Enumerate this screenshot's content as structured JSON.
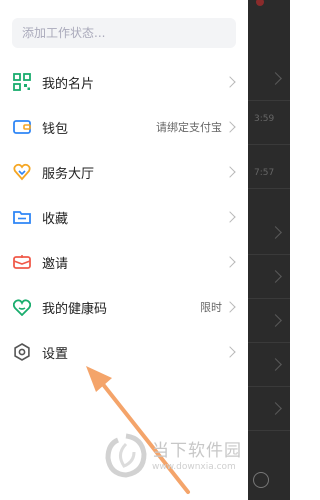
{
  "status": {
    "placeholder": "添加工作状态..."
  },
  "menu": [
    {
      "label": "我的名片",
      "hint": "",
      "icon": "qr-card-icon"
    },
    {
      "label": "钱包",
      "hint": "请绑定支付宝",
      "icon": "wallet-icon"
    },
    {
      "label": "服务大厅",
      "hint": "",
      "icon": "service-hall-icon"
    },
    {
      "label": "收藏",
      "hint": "",
      "icon": "favorites-icon"
    },
    {
      "label": "邀请",
      "hint": "",
      "icon": "invite-icon"
    },
    {
      "label": "我的健康码",
      "hint": "限时",
      "icon": "health-code-icon"
    },
    {
      "label": "设置",
      "hint": "",
      "icon": "gear-icon"
    }
  ],
  "background": {
    "times": [
      "3:59",
      "7:57"
    ]
  },
  "watermark": {
    "title": "当下软件园",
    "url": "www.downxia.com"
  },
  "colors": {
    "green": "#1aad6e",
    "blue": "#2f86f6",
    "orange": "#f5a623",
    "red": "#f05a4a",
    "arrow": "#f4a46a"
  }
}
